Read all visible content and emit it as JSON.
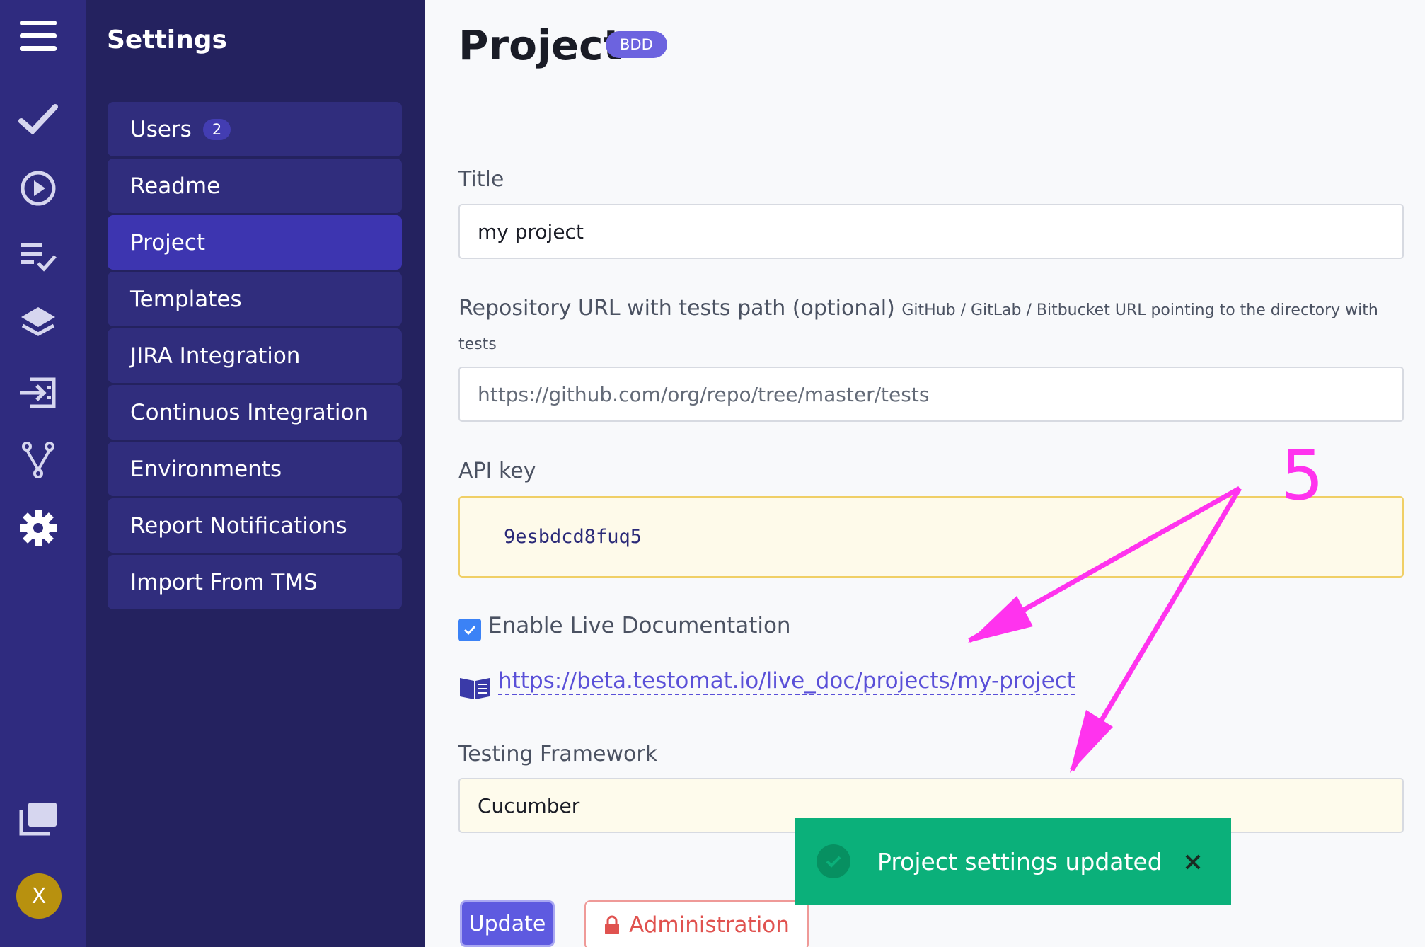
{
  "rail": {
    "icons": [
      "menu-icon",
      "check-icon",
      "play-circle-icon",
      "checklist-icon",
      "layers-icon",
      "import-icon",
      "branch-icon",
      "gear-icon",
      "folders-icon"
    ],
    "avatar_letter": "X",
    "avatar_color": "#b8910f"
  },
  "sidebar": {
    "title": "Settings",
    "items": [
      {
        "label": "Users",
        "badge": "2"
      },
      {
        "label": "Readme"
      },
      {
        "label": "Project",
        "active": true
      },
      {
        "label": "Templates"
      },
      {
        "label": "JIRA Integration"
      },
      {
        "label": "Continuos Integration"
      },
      {
        "label": "Environments"
      },
      {
        "label": "Report Notifications"
      },
      {
        "label": "Import From TMS"
      }
    ]
  },
  "main": {
    "title": "Project",
    "badge": "BDD",
    "title_field": {
      "label": "Title",
      "value": "my project"
    },
    "repo_field": {
      "label": "Repository URL with tests path (optional)",
      "hint": "GitHub / GitLab / Bitbucket URL pointing to the directory with",
      "hint_cont": "tests",
      "placeholder": "https://github.com/org/repo/tree/master/tests"
    },
    "api_key": {
      "label": "API key",
      "value": "9esbdcd8fuq5"
    },
    "live_doc": {
      "label": "Enable Live Documentation",
      "checked": true,
      "link": "https://beta.testomat.io/live_doc/projects/my-project"
    },
    "framework": {
      "label": "Testing Framework",
      "value": "Cucumber"
    },
    "update_label": "Update",
    "admin_label": "Administration"
  },
  "toast": {
    "message": "Project settings updated",
    "close_symbol": "✕"
  },
  "annotation": {
    "number": "5",
    "color": "#ff33ee"
  },
  "colors": {
    "rail": "#2f2b7f",
    "sidebar": "#24225f",
    "active": "#3d35b0",
    "accent": "#5e5ae0",
    "toast": "#0bb07a"
  }
}
